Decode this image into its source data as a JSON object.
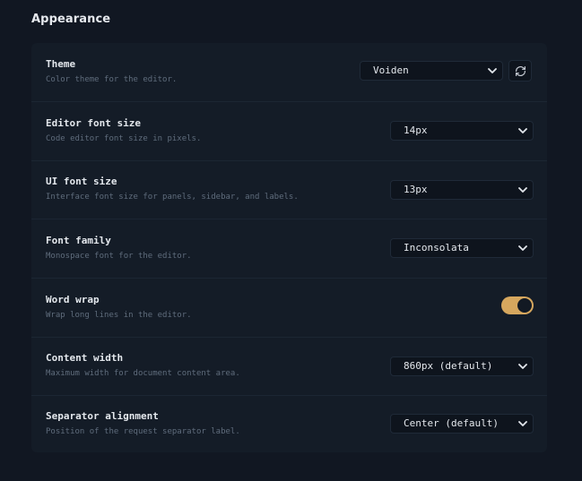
{
  "section": {
    "title": "Appearance"
  },
  "settings": {
    "theme": {
      "title": "Theme",
      "description": "Color theme for the editor.",
      "value": "Voiden",
      "icon": "refresh-icon"
    },
    "editor_font_size": {
      "title": "Editor font size",
      "description": "Code editor font size in pixels.",
      "value": "14px"
    },
    "ui_font_size": {
      "title": "UI font size",
      "description": "Interface font size for panels, sidebar, and labels.",
      "value": "13px"
    },
    "font_family": {
      "title": "Font family",
      "description": "Monospace font for the editor.",
      "value": "Inconsolata"
    },
    "word_wrap": {
      "title": "Word wrap",
      "description": "Wrap long lines in the editor.",
      "enabled": true
    },
    "content_width": {
      "title": "Content width",
      "description": "Maximum width for document content area.",
      "value": "860px (default)"
    },
    "separator_alignment": {
      "title": "Separator alignment",
      "description": "Position of the request separator label.",
      "value": "Center (default)"
    }
  },
  "colors": {
    "background": "#111722",
    "card": "#141c27",
    "accent_toggle": "#d6a75e",
    "text_primary": "#e3e7ec",
    "text_muted": "#5f6c7c"
  }
}
